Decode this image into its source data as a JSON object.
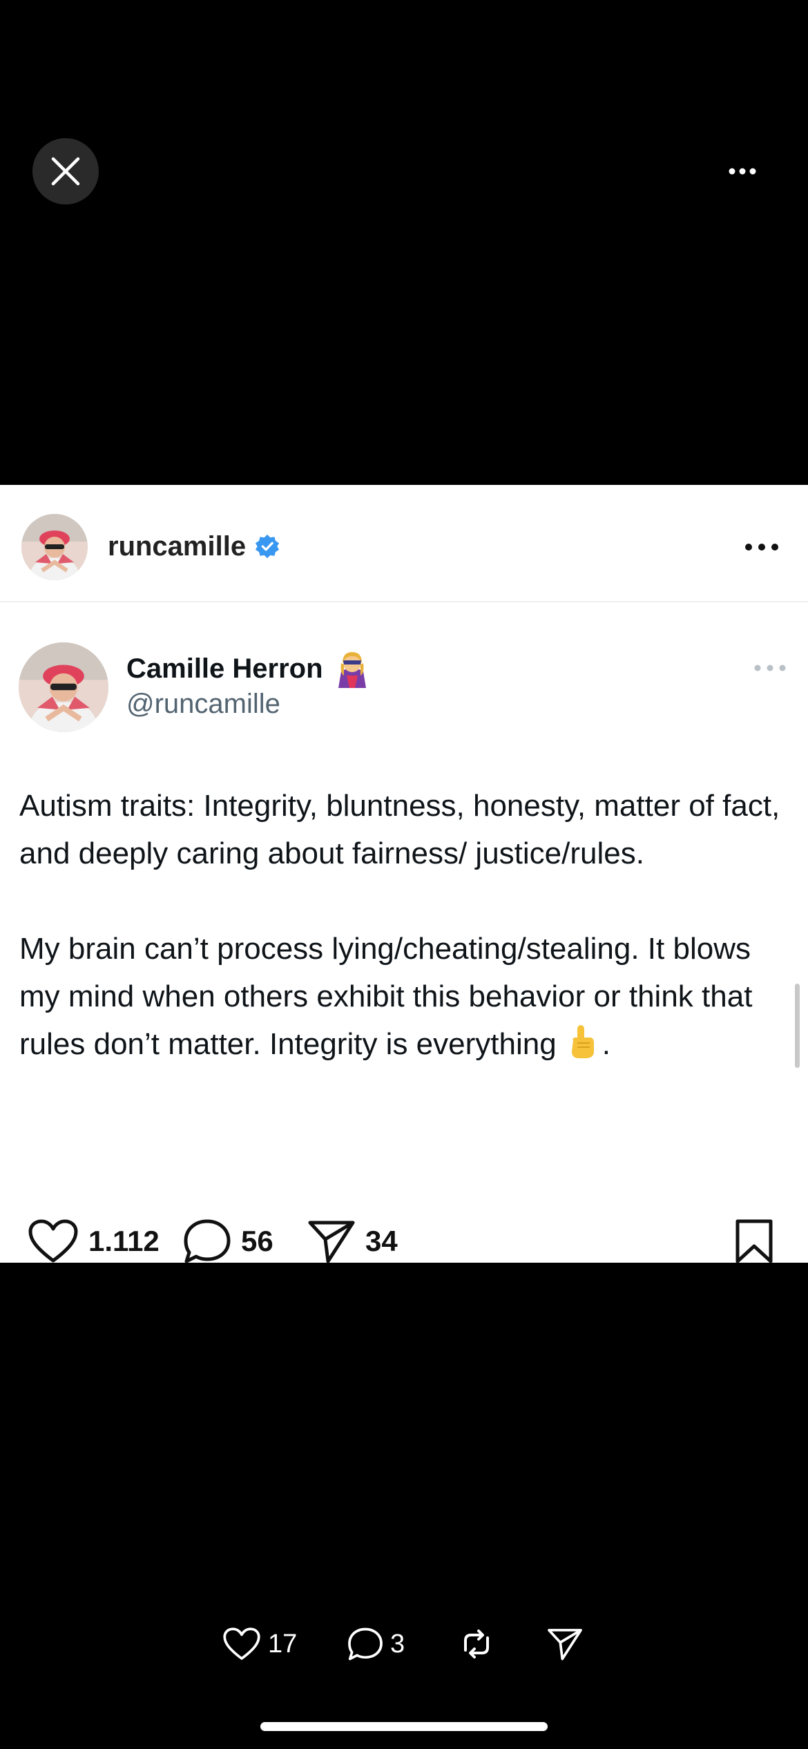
{
  "viewer": {
    "close_icon": "close-icon",
    "more_icon": "more-horizontal-icon"
  },
  "post": {
    "username": "runcamille",
    "verified_icon": "verified-badge-icon",
    "more_icon": "more-horizontal-icon"
  },
  "tweet": {
    "display_name": "Camille Herron",
    "name_emoji": "🦸‍♀️",
    "handle": "@runcamille",
    "paragraph_1": "Autism traits: Integrity, bluntness, honesty, matter of fact, and deeply caring about fairness/ justice/rules.",
    "paragraph_2": "My brain can’t process lying/cheating/stealing. It blows my mind when others exhibit this behavior or think that rules don’t matter. Integrity is everything",
    "paragraph_2_end": "☝️",
    "paragraph_2_tail": ".",
    "likes": "1.112",
    "comments": "56",
    "shares": "34"
  },
  "viewer_actions": {
    "likes": "17",
    "comments": "3"
  },
  "colors": {
    "background": "#000000",
    "card": "#ffffff",
    "verified": "#3897f0",
    "handle": "#536471"
  }
}
